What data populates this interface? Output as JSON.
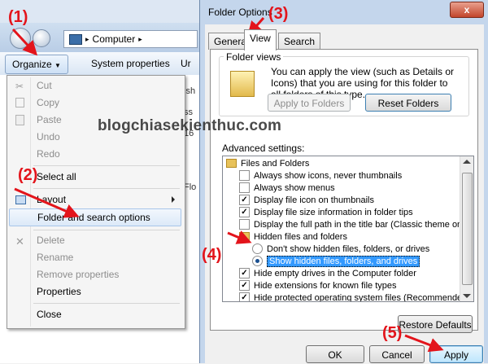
{
  "explorer": {
    "address": "Computer",
    "toolbar": {
      "organize": "Organize",
      "system_properties": "System properties",
      "uninstall_fragment": "Ur"
    },
    "background_fragments": [
      "ish",
      "ss",
      "16",
      "Flo"
    ]
  },
  "organize_menu": {
    "items": [
      {
        "label": "Cut",
        "icon": "scissors-icon",
        "enabled": false
      },
      {
        "label": "Copy",
        "icon": "copy-icon",
        "enabled": false
      },
      {
        "label": "Paste",
        "icon": "paste-icon",
        "enabled": false
      },
      {
        "label": "Undo",
        "enabled": false
      },
      {
        "label": "Redo",
        "enabled": false
      },
      {
        "label": "Select all",
        "enabled": true
      },
      {
        "label": "Layout",
        "icon": "layout-icon",
        "enabled": true,
        "submenu": true
      },
      {
        "label": "Folder and search options",
        "enabled": true,
        "highlighted": true
      },
      {
        "label": "Delete",
        "icon": "delete-icon",
        "enabled": false
      },
      {
        "label": "Rename",
        "enabled": false
      },
      {
        "label": "Remove properties",
        "enabled": false
      },
      {
        "label": "Properties",
        "enabled": true
      },
      {
        "label": "Close",
        "enabled": true
      }
    ]
  },
  "dialog": {
    "title": "Folder Options",
    "tabs": [
      "General",
      "View",
      "Search"
    ],
    "active_tab": "View",
    "folder_views": {
      "legend": "Folder views",
      "text": "You can apply the view (such as Details or Icons) that you are using for this folder to all folders of this type.",
      "apply_button": "Apply to Folders",
      "reset_button": "Reset Folders"
    },
    "advanced_label": "Advanced settings:",
    "advanced": [
      {
        "kind": "folder",
        "label": "Files and Folders"
      },
      {
        "kind": "checkbox",
        "label": "Always show icons, never thumbnails",
        "checked": false
      },
      {
        "kind": "checkbox",
        "label": "Always show menus",
        "checked": false
      },
      {
        "kind": "checkbox",
        "label": "Display file icon on thumbnails",
        "checked": true
      },
      {
        "kind": "checkbox",
        "label": "Display file size information in folder tips",
        "checked": true
      },
      {
        "kind": "checkbox",
        "label": "Display the full path in the title bar (Classic theme only)",
        "checked": false
      },
      {
        "kind": "folder",
        "label": "Hidden files and folders"
      },
      {
        "kind": "radio",
        "label": "Don't show hidden files, folders, or drives",
        "checked": false
      },
      {
        "kind": "radio",
        "label": "Show hidden files, folders, and drives",
        "checked": true,
        "selected": true
      },
      {
        "kind": "checkbox",
        "label": "Hide empty drives in the Computer folder",
        "checked": true
      },
      {
        "kind": "checkbox",
        "label": "Hide extensions for known file types",
        "checked": true
      },
      {
        "kind": "checkbox",
        "label": "Hide protected operating system files (Recommended)",
        "checked": true
      }
    ],
    "restore_button": "Restore Defaults",
    "ok_button": "OK",
    "cancel_button": "Cancel",
    "apply_button": "Apply",
    "close_glyph": "x"
  },
  "annotations": [
    "(1)",
    "(2)",
    "(3)",
    "(4)",
    "(5)"
  ],
  "watermark": "blogchiasekienthuc.com",
  "colors": {
    "annotation": "#e3141b",
    "selection": "#3399ff"
  }
}
